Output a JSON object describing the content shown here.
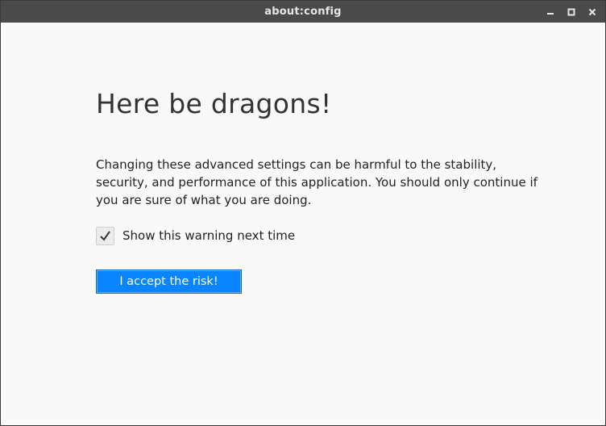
{
  "window": {
    "title": "about:config"
  },
  "page": {
    "heading": "Here be dragons!",
    "warning": "Changing these advanced settings can be harmful to the stability, security, and performance of this application. You should only continue if you are sure of what you are doing.",
    "checkbox_label": "Show this warning next time",
    "checkbox_checked": true,
    "accept_button": "I accept the risk!"
  },
  "colors": {
    "titlebar": "#4a4a4a",
    "page_background": "#f9f9f9",
    "accent": "#0a84ff"
  },
  "icons": {
    "minimize": "minimize-icon",
    "maximize": "maximize-icon",
    "close": "close-icon",
    "check": "checkmark-icon"
  }
}
